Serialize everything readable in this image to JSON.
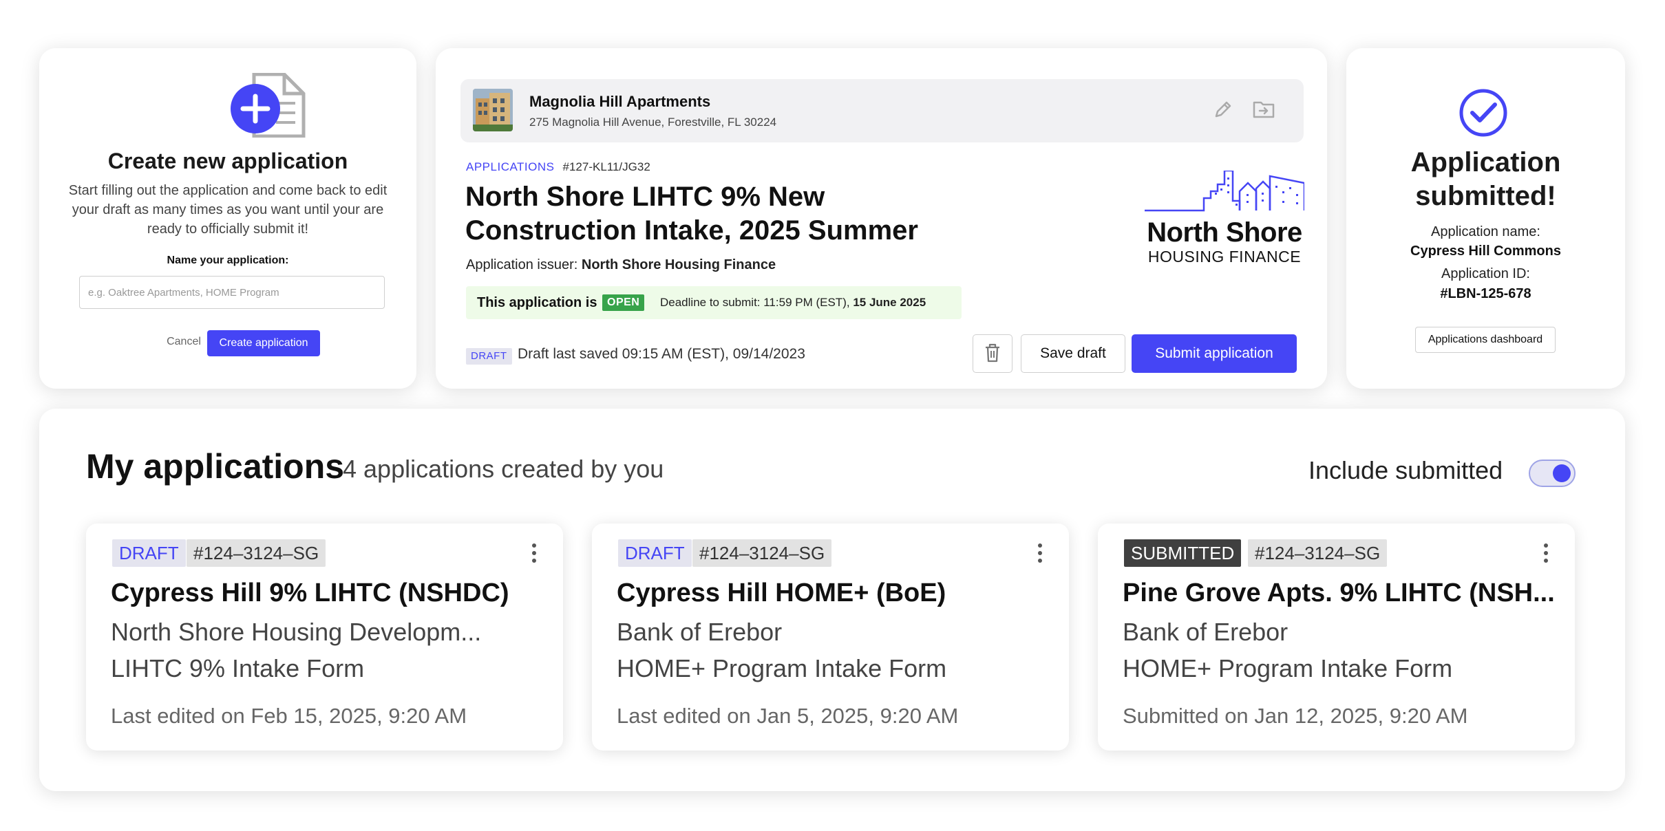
{
  "create_card": {
    "title": "Create new application",
    "description": "Start filling out the application and come back to edit your draft as many times as you want until your are ready to officially submit it!",
    "name_label": "Name your application:",
    "name_placeholder": "e.g. Oaktree Apartments, HOME Program",
    "cancel_label": "Cancel",
    "create_label": "Create application"
  },
  "detail": {
    "property": {
      "name": "Magnolia Hill Apartments",
      "address": "275 Magnolia Hill Avenue,  Forestville, FL 30224"
    },
    "breadcrumb_category": "APPLICATIONS",
    "breadcrumb_id": "#127-KL11/JG32",
    "title": "North Shore LIHTC 9% New Construction Intake, 2025 Summer",
    "issuer_label": "Application issuer:",
    "issuer_name": "North Shore Housing Finance",
    "status_label": "This application is",
    "status_badge": "OPEN",
    "deadline_label": "Deadline to submit: 11:59 PM (EST),",
    "deadline_date": "15 June 2025",
    "draft_badge": "DRAFT",
    "saved_text": "Draft last saved 09:15 AM (EST), 09/14/2023",
    "save_label": "Save draft",
    "submit_label": "Submit application",
    "logo_name": "North Shore",
    "logo_sub": "HOUSING FINANCE"
  },
  "submitted_card": {
    "title": "Application submitted!",
    "name_key": "Application name:",
    "name_value": "Cypress Hill Commons",
    "id_key": "Application ID:",
    "id_value": "#LBN-125-678",
    "dashboard_label": "Applications dashboard"
  },
  "my_apps": {
    "title": "My applications",
    "count_text": "4 applications created by you",
    "include_label": "Include submitted",
    "include_on": true,
    "cards": [
      {
        "status": "DRAFT",
        "id": "#124–3124–SG",
        "title": "Cypress Hill 9% LIHTC (NSHDC)",
        "org": "North Shore Housing Developm...",
        "form": "LIHTC 9% Intake Form",
        "edited": "Last edited on Feb 15, 2025, 9:20 AM"
      },
      {
        "status": "DRAFT",
        "id": "#124–3124–SG",
        "title": "Cypress Hill HOME+ (BoE)",
        "org": "Bank of Erebor",
        "form": "HOME+ Program Intake Form",
        "edited": "Last edited on Jan 5, 2025, 9:20 AM"
      },
      {
        "status": "SUBMITTED",
        "id": "#124–3124–SG",
        "title": "Pine Grove Apts. 9% LIHTC (NSH...",
        "org": "Bank of Erebor",
        "form": "HOME+ Program Intake Form",
        "edited": "Submitted on Jan 12, 2025, 9:20 AM"
      }
    ]
  },
  "colors": {
    "accent": "#4545f5",
    "open_green": "#37a34a",
    "status_bg": "#eefbe8",
    "submitted_badge": "#404040"
  },
  "icons": [
    "document-plus-icon",
    "pencil-icon",
    "folder-move-icon",
    "trash-icon",
    "check-circle-icon",
    "more-vertical-icon",
    "city-skyline-logo"
  ]
}
